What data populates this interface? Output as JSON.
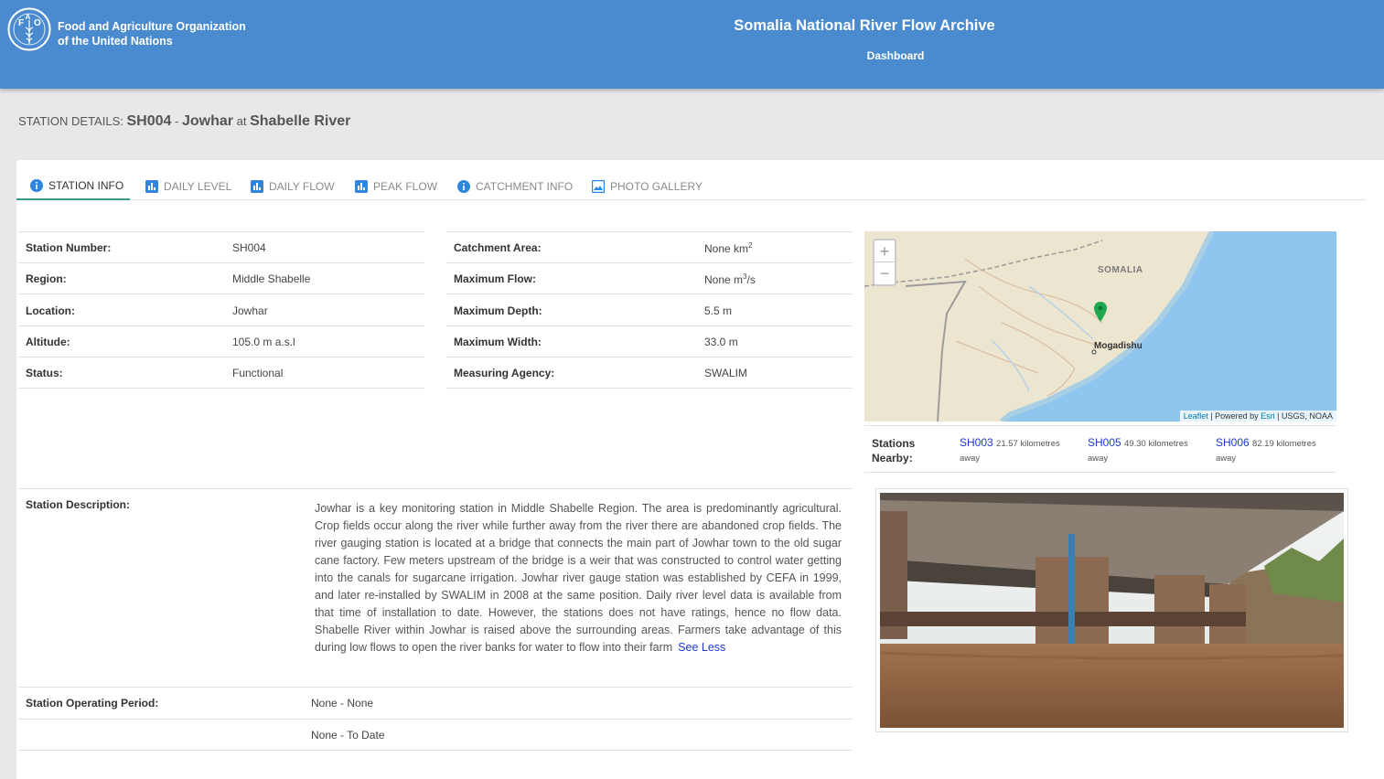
{
  "header": {
    "org_line1": "Food and Agriculture Organization",
    "org_line2": "of the United Nations",
    "logo_letters": "FAO",
    "app_title": "Somalia National River Flow Archive",
    "nav_dashboard": "Dashboard",
    "color": "#4a8bd0"
  },
  "heading": {
    "prefix": "STATION DETAILS:",
    "code": "SH004",
    "dash": "-",
    "station": "Jowhar",
    "at": "at",
    "river": "Shabelle River"
  },
  "tabs": [
    {
      "label": "STATION INFO",
      "icon": "info-icon",
      "active": true
    },
    {
      "label": "DAILY LEVEL",
      "icon": "bar-chart-icon"
    },
    {
      "label": "DAILY FLOW",
      "icon": "bar-chart-icon"
    },
    {
      "label": "PEAK FLOW",
      "icon": "bar-chart-icon"
    },
    {
      "label": "CATCHMENT INFO",
      "icon": "info-icon"
    },
    {
      "label": "PHOTO GALLERY",
      "icon": "image-icon"
    }
  ],
  "left_table": [
    {
      "label": "Station Number:",
      "value": "SH004"
    },
    {
      "label": "Region:",
      "value": "Middle Shabelle"
    },
    {
      "label": "Location:",
      "value": "Jowhar"
    },
    {
      "label": "Altitude:",
      "value": "105.0 m a.s.l"
    },
    {
      "label": "Status:",
      "value": "Functional"
    }
  ],
  "right_table": [
    {
      "label": "Catchment Area:",
      "value": "None km",
      "sup": "2"
    },
    {
      "label": "Maximum Flow:",
      "value": "None m",
      "sup": "3",
      "suffix": "/s"
    },
    {
      "label": "Maximum Depth:",
      "value": "5.5 m"
    },
    {
      "label": "Maximum Width:",
      "value": "33.0 m"
    },
    {
      "label": "Measuring Agency:",
      "value": "SWALIM"
    }
  ],
  "map": {
    "country_label": "SOMALIA",
    "city_label": "Mogadishu",
    "zoom_in": "+",
    "zoom_out": "−",
    "attribution_leaflet": "Leaflet",
    "attribution_sep": " | Powered by ",
    "attribution_esri": "Esri",
    "attribution_rest": " | USGS, NOAA"
  },
  "nearby": {
    "label_line1": "Stations",
    "label_line2": "Nearby:",
    "items": [
      {
        "code": "SH003",
        "dist1": "21.57 kilometres",
        "dist2": "away"
      },
      {
        "code": "SH005",
        "dist1": "49.30 kilometres",
        "dist2": "away"
      },
      {
        "code": "SH006",
        "dist1": "82.19 kilometres",
        "dist2": "away"
      }
    ]
  },
  "description": {
    "label": "Station Description:",
    "text": "Jowhar is a key monitoring station in Middle Shabelle Region. The area is predominantly agricultural. Crop fields occur along the river while further away from the river there are abandoned crop fields. The river gauging station is located at a bridge that connects the main part of Jowhar town to the old sugar cane factory. Few meters upstream of the bridge is a weir that was constructed to control water getting into the canals for sugarcane irrigation. Jowhar river gauge station was established by CEFA in 1999, and later re-installed by SWALIM in 2008 at the same position. Daily river level data is available from that time of installation to date. However, the stations does not have ratings, hence no flow data. Shabelle River within Jowhar is raised above the surrounding areas. Farmers take advantage of this during low flows to open the river banks for water to flow into their farm",
    "toggle": "See Less"
  },
  "operating": {
    "label": "Station Operating Period:",
    "period1": "None - None",
    "period2": "None - To Date"
  }
}
